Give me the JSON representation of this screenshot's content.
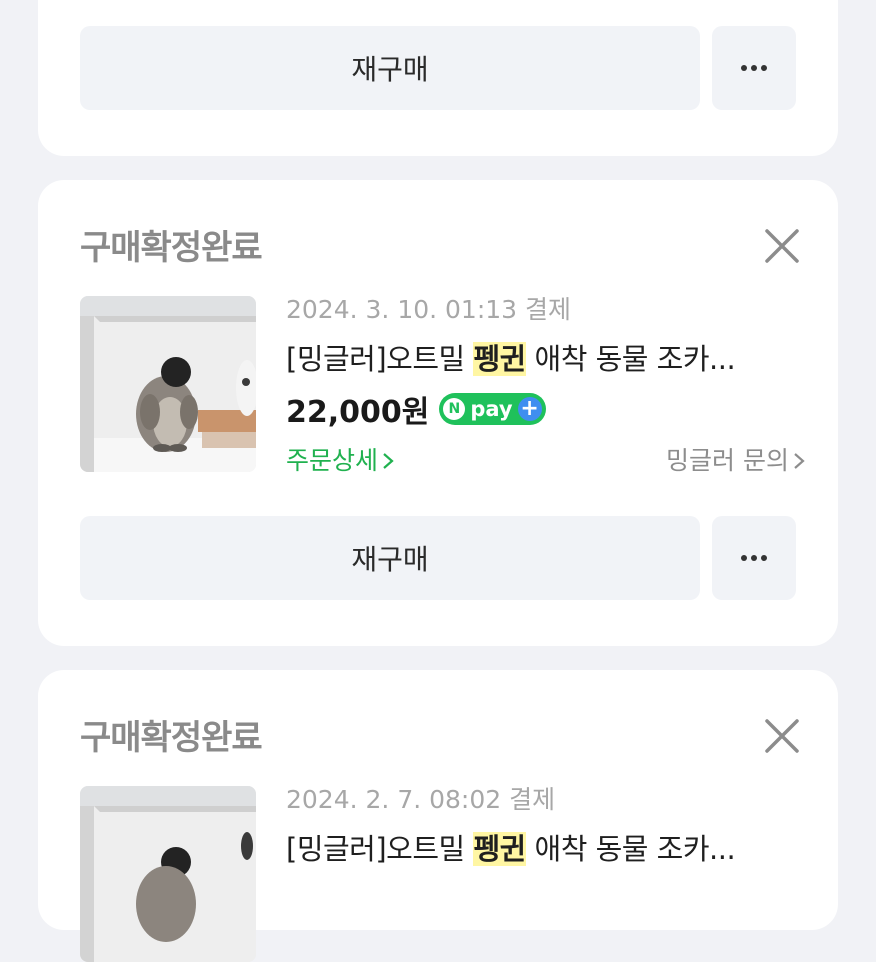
{
  "actions": {
    "rebuy_label": "재구매"
  },
  "orders": [
    {
      "status": "구매확정완료",
      "date": "2024. 3. 10. 01:13",
      "payment_label": "결제",
      "title_prefix": "[밍글러]오트밀 ",
      "title_highlight": "펭귄",
      "title_suffix": " 애착 동물 조카...",
      "price": "22,000원",
      "npay": "pay",
      "detail_link": "주문상세",
      "seller_link": "밍글러 문의"
    },
    {
      "status": "구매확정완료",
      "date": "2024. 2. 7. 08:02",
      "payment_label": "결제",
      "title_prefix": "[밍글러]오트밀 ",
      "title_highlight": "펭귄",
      "title_suffix": " 애착 동물 조카..."
    }
  ],
  "colors": {
    "page_bg": "#f1f2f6",
    "card_bg": "#ffffff",
    "status_text": "#8a8a8a",
    "link_green": "#20b14f",
    "highlight": "#fff6a3",
    "npay_green": "#1fc15b",
    "npay_plus": "#3f8ef0"
  },
  "icons": {
    "close": "close-icon",
    "more": "more-dots-icon",
    "chevron": "chevron-right-icon"
  }
}
